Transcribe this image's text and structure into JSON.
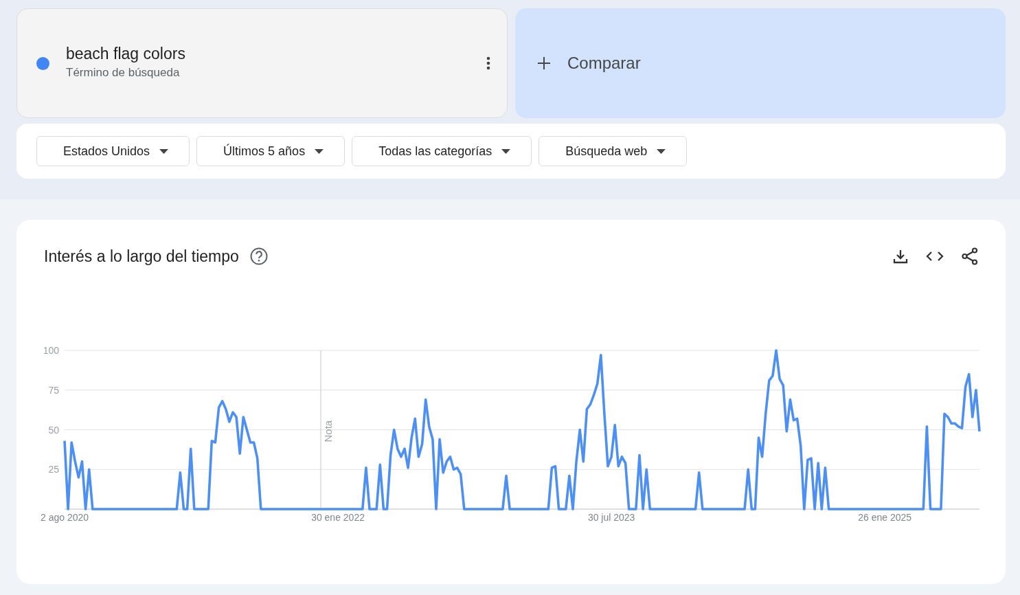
{
  "term": {
    "name": "beach flag colors",
    "subtitle": "Término de búsqueda",
    "color": "#4285f4"
  },
  "compare": {
    "label": "Comparar"
  },
  "filters": [
    {
      "label": "Estados Unidos"
    },
    {
      "label": "Últimos 5 años"
    },
    {
      "label": "Todas las categorías"
    },
    {
      "label": "Búsqueda web"
    }
  ],
  "interest": {
    "title": "Interés a lo largo del tiempo",
    "chart_data": {
      "type": "line",
      "categories": [
        "2 ago 2020",
        null,
        null,
        null,
        null,
        null,
        null,
        null,
        null,
        null,
        null,
        null,
        null,
        null,
        null,
        null,
        null,
        null,
        null,
        null,
        null,
        null,
        null,
        null,
        null,
        null,
        null,
        null,
        null,
        null,
        null,
        null,
        null,
        null,
        null,
        null,
        null,
        null,
        null,
        null,
        null,
        null,
        null,
        null,
        null,
        null,
        null,
        null,
        null,
        null,
        null,
        null,
        null,
        null,
        null,
        null,
        null,
        null,
        null,
        null,
        null,
        null,
        null,
        null,
        null,
        null,
        null,
        null,
        null,
        null,
        null,
        null,
        null,
        null,
        null,
        null,
        null,
        null,
        "30 ene 2022",
        null,
        null,
        null,
        null,
        null,
        null,
        null,
        null,
        null,
        null,
        null,
        null,
        null,
        null,
        null,
        null,
        null,
        null,
        null,
        null,
        null,
        null,
        null,
        null,
        null,
        null,
        null,
        null,
        null,
        null,
        null,
        null,
        null,
        null,
        null,
        null,
        null,
        null,
        null,
        null,
        null,
        null,
        null,
        null,
        null,
        null,
        null,
        null,
        null,
        null,
        null,
        null,
        null,
        null,
        null,
        null,
        null,
        null,
        null,
        null,
        null,
        null,
        null,
        null,
        null,
        null,
        null,
        null,
        null,
        null,
        null,
        null,
        null,
        null,
        null,
        null,
        null,
        "30 jul 2023",
        null,
        null,
        null,
        null,
        null,
        null,
        null,
        null,
        null,
        null,
        null,
        null,
        null,
        null,
        null,
        null,
        null,
        null,
        null,
        null,
        null,
        null,
        null,
        null,
        null,
        null,
        null,
        null,
        null,
        null,
        null,
        null,
        null,
        null,
        null,
        null,
        null,
        null,
        null,
        null,
        null,
        null,
        null,
        null,
        null,
        null,
        null,
        null,
        null,
        null,
        null,
        null,
        null,
        null,
        null,
        null,
        null,
        null,
        null,
        null,
        null,
        null,
        null,
        null,
        null,
        null,
        null,
        null,
        null,
        null,
        null,
        null,
        null,
        null,
        null,
        null,
        null,
        "26 ene 2025",
        null,
        null,
        null,
        null,
        null,
        null,
        null,
        null,
        null,
        null,
        null,
        null,
        null,
        null,
        null,
        null,
        null,
        null,
        null,
        null,
        null,
        null,
        null,
        null,
        null,
        null,
        null
      ],
      "series": [
        {
          "color": "#4d8ff2",
          "values": [
            43,
            0,
            42,
            30,
            20,
            30,
            0,
            25,
            0,
            0,
            0,
            0,
            0,
            0,
            0,
            0,
            0,
            0,
            0,
            0,
            0,
            0,
            0,
            0,
            0,
            0,
            0,
            0,
            0,
            0,
            0,
            0,
            0,
            23,
            0,
            0,
            38,
            0,
            0,
            0,
            0,
            0,
            43,
            42,
            64,
            68,
            63,
            55,
            61,
            58,
            35,
            58,
            50,
            42,
            42,
            32,
            0,
            0,
            0,
            0,
            0,
            0,
            0,
            0,
            0,
            0,
            0,
            0,
            0,
            0,
            0,
            0,
            0,
            0,
            0,
            0,
            0,
            0,
            0,
            0,
            0,
            0,
            0,
            0,
            0,
            0,
            26,
            0,
            0,
            0,
            28,
            0,
            0,
            34,
            50,
            38,
            33,
            38,
            26,
            45,
            57,
            33,
            41,
            69,
            52,
            44,
            0,
            44,
            23,
            30,
            33,
            25,
            26,
            22,
            0,
            0,
            0,
            0,
            0,
            0,
            0,
            0,
            0,
            0,
            0,
            0,
            21,
            0,
            0,
            0,
            0,
            0,
            0,
            0,
            0,
            0,
            0,
            0,
            0,
            26,
            27,
            0,
            0,
            0,
            21,
            0,
            30,
            50,
            30,
            63,
            66,
            72,
            79,
            97,
            60,
            27,
            33,
            53,
            27,
            33,
            29,
            0,
            0,
            0,
            34,
            0,
            25,
            0,
            0,
            0,
            0,
            0,
            0,
            0,
            0,
            0,
            0,
            0,
            0,
            0,
            0,
            23,
            0,
            0,
            0,
            0,
            0,
            0,
            0,
            0,
            0,
            0,
            0,
            0,
            0,
            25,
            0,
            0,
            45,
            33,
            60,
            81,
            84,
            100,
            82,
            78,
            49,
            69,
            56,
            57,
            40,
            0,
            31,
            32,
            0,
            29,
            0,
            26,
            0,
            0,
            0,
            0,
            0,
            0,
            0,
            0,
            0,
            0,
            0,
            0,
            0,
            0,
            0,
            0,
            0,
            0,
            0,
            0,
            0,
            0,
            0,
            0,
            0,
            0,
            0,
            0,
            52,
            0,
            0,
            0,
            0,
            60,
            58,
            54,
            54,
            52,
            51,
            77,
            85,
            58,
            75,
            49
          ]
        }
      ],
      "ylim": [
        0,
        100
      ],
      "grid": true,
      "yticks": [
        25,
        50,
        75,
        100
      ],
      "annotations": [
        "Nota"
      ]
    }
  }
}
